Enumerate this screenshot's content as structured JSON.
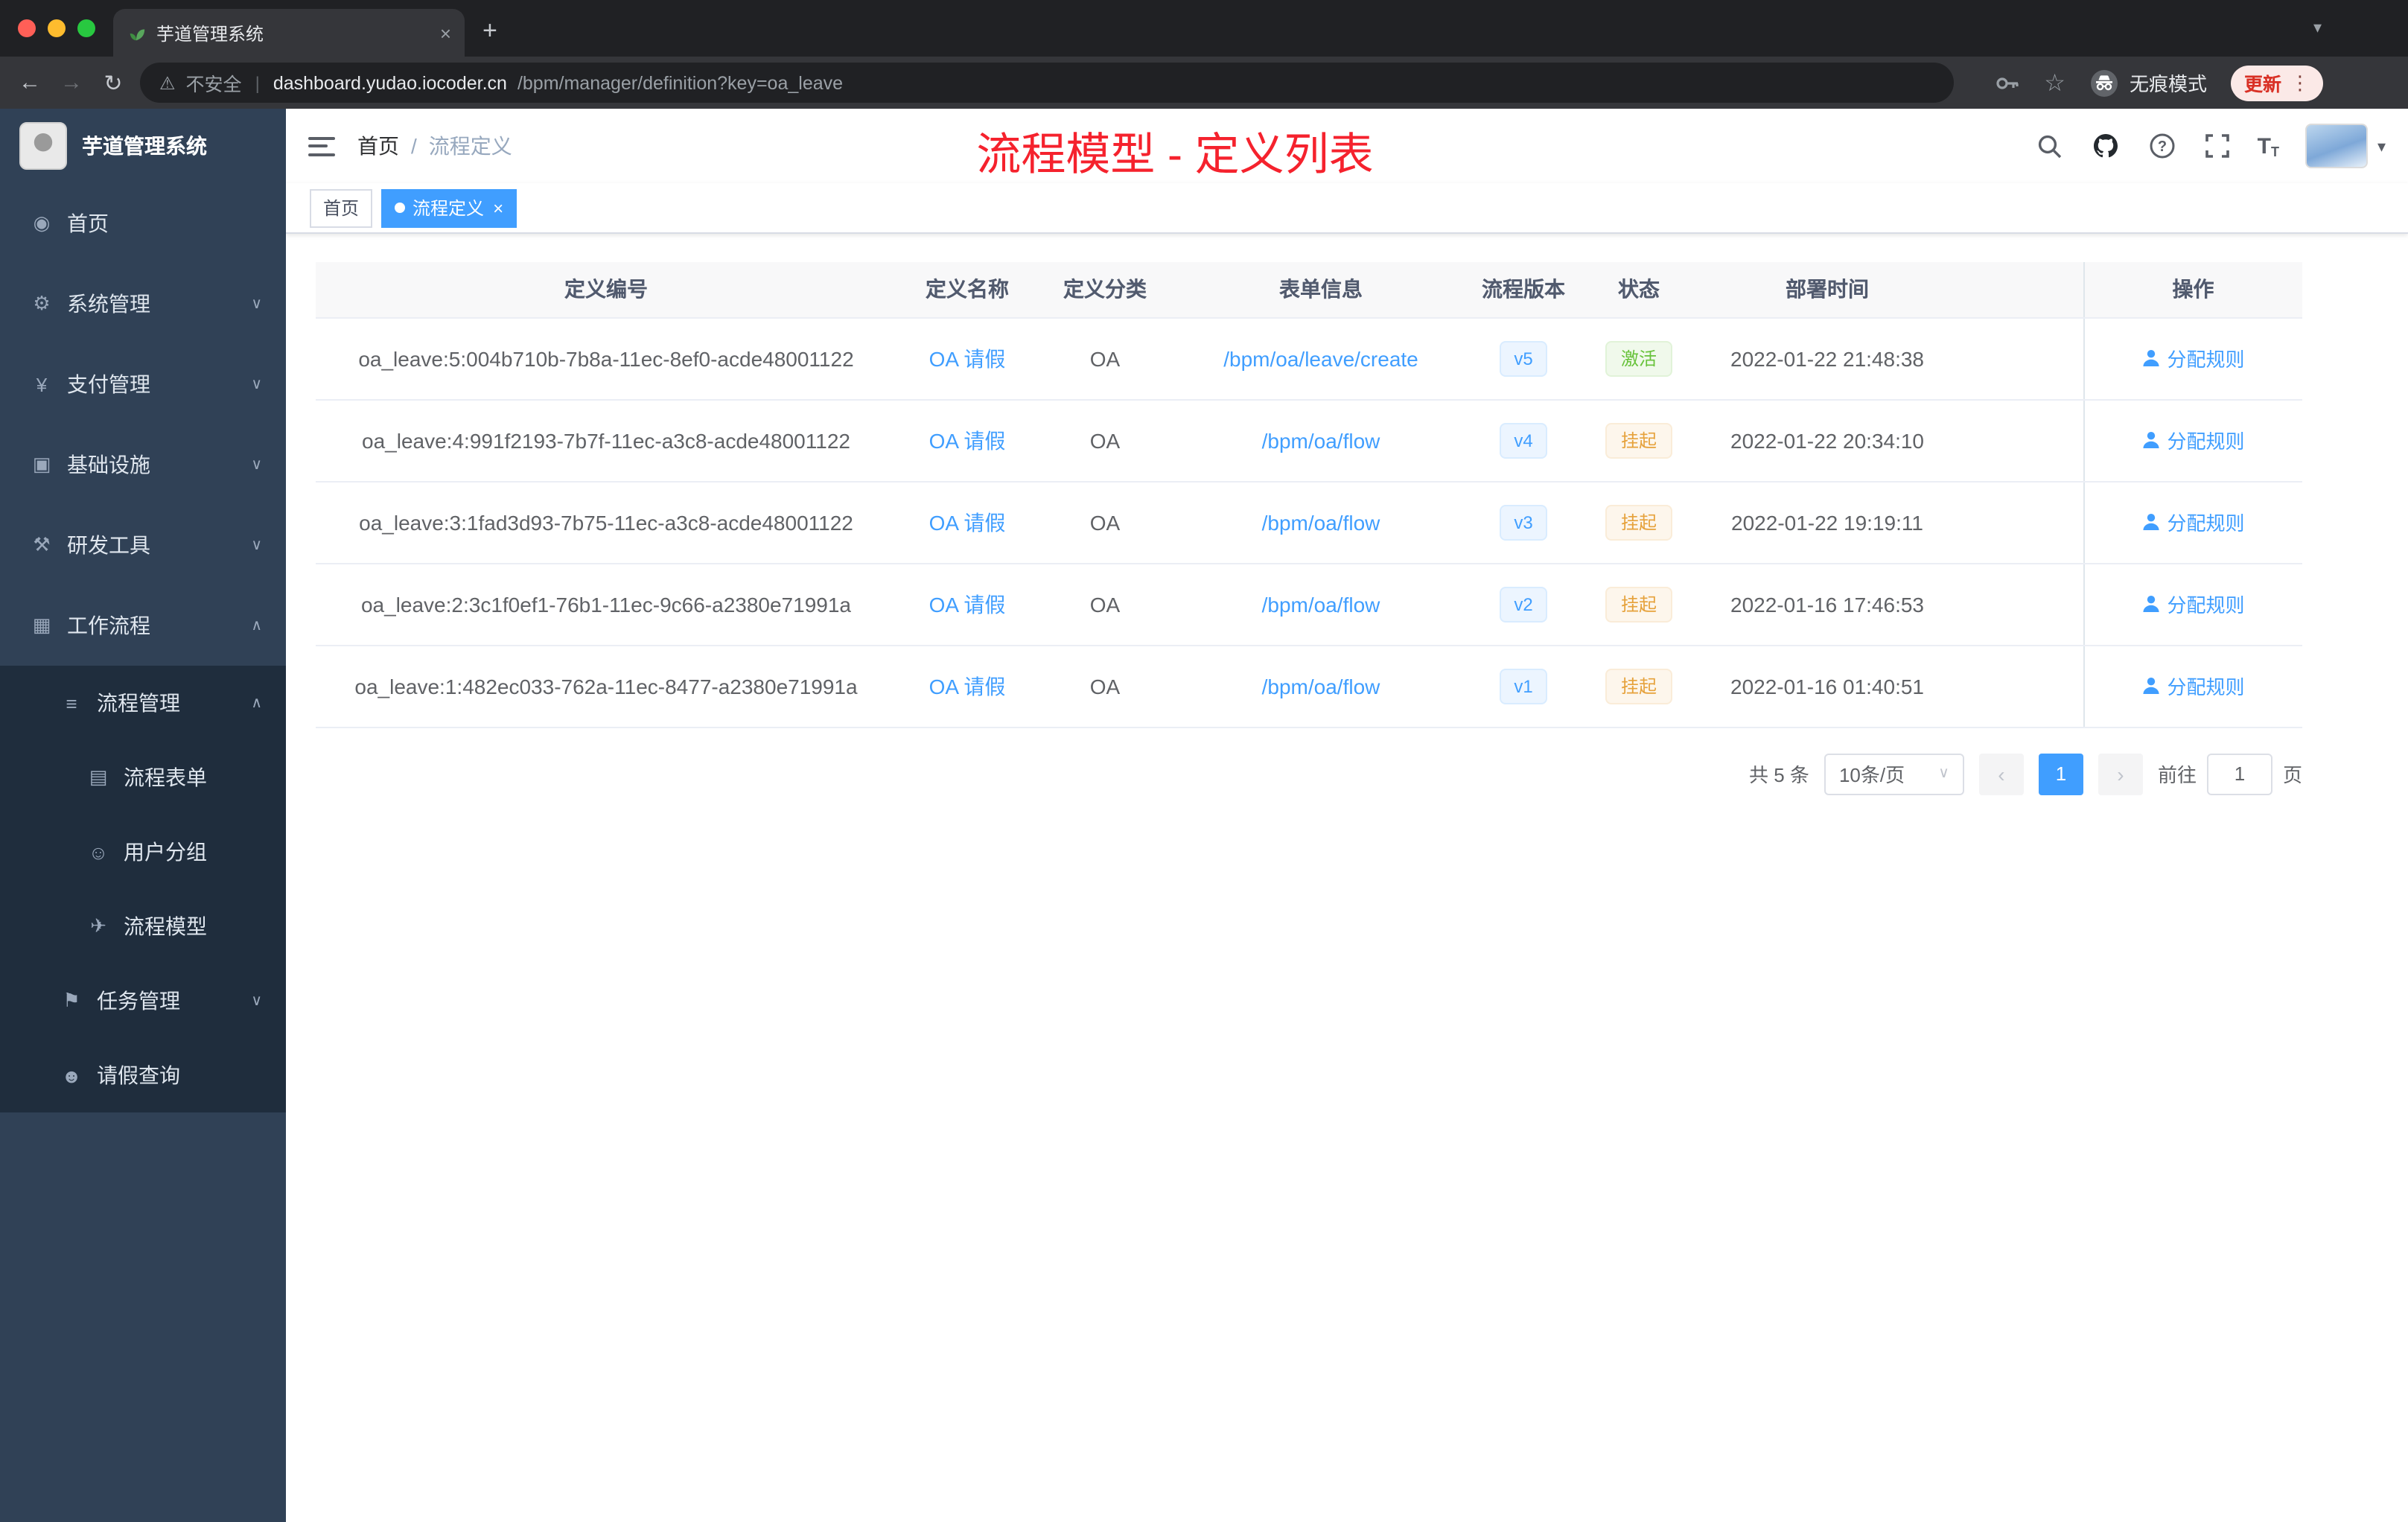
{
  "browser": {
    "tab_title": "芋道管理系统",
    "security_label": "不安全",
    "url_host": "dashboard.yudao.iocoder.cn",
    "url_path": "/bpm/manager/definition?key=oa_leave",
    "incognito_label": "无痕模式",
    "update_label": "更新"
  },
  "sidebar": {
    "logo_title": "芋道管理系统",
    "menu": [
      {
        "key": "home",
        "label": "首页",
        "icon": "dashboard-icon",
        "level": "top"
      },
      {
        "key": "system",
        "label": "系统管理",
        "icon": "gear-icon",
        "level": "top",
        "chevron": "down"
      },
      {
        "key": "payment",
        "label": "支付管理",
        "icon": "yen-icon",
        "level": "top",
        "chevron": "down"
      },
      {
        "key": "infrastructure",
        "label": "基础设施",
        "icon": "infrastructure-icon",
        "level": "top",
        "chevron": "down"
      },
      {
        "key": "devtools",
        "label": "研发工具",
        "icon": "tools-icon",
        "level": "top",
        "chevron": "down"
      },
      {
        "key": "workflow",
        "label": "工作流程",
        "icon": "workflow-icon",
        "level": "top",
        "chevron": "up"
      },
      {
        "key": "process-management",
        "label": "流程管理",
        "icon": "process-list-icon",
        "level": "sub1",
        "chevron": "up",
        "dark": true
      },
      {
        "key": "process-form",
        "label": "流程表单",
        "icon": "form-icon",
        "level": "sub2",
        "dark": true
      },
      {
        "key": "user-group",
        "label": "用户分组",
        "icon": "user-group-icon",
        "level": "sub2",
        "dark": true
      },
      {
        "key": "process-model",
        "label": "流程模型",
        "icon": "paper-plane-icon",
        "level": "sub2",
        "dark": true
      },
      {
        "key": "task-management",
        "label": "任务管理",
        "icon": "task-icon",
        "level": "sub1",
        "chevron": "down",
        "dark": true
      },
      {
        "key": "leave-query",
        "label": "请假查询",
        "icon": "person-icon",
        "level": "sub1",
        "dark": true
      }
    ]
  },
  "navbar": {
    "breadcrumb": [
      "首页",
      "流程定义"
    ],
    "breadcrumb_separator": "/",
    "annotation": "流程模型 - 定义列表"
  },
  "tags": {
    "items": [
      {
        "label": "首页",
        "active": false
      },
      {
        "label": "流程定义",
        "active": true
      }
    ]
  },
  "table": {
    "columns": [
      "定义编号",
      "定义名称",
      "定义分类",
      "表单信息",
      "流程版本",
      "状态",
      "部署时间",
      "操作"
    ],
    "rows": [
      {
        "id": "oa_leave:5:004b710b-7b8a-11ec-8ef0-acde48001122",
        "name": "OA 请假",
        "category": "OA",
        "form": "/bpm/oa/leave/create",
        "version": "v5",
        "status": "激活",
        "status_type": "success",
        "deploy_time": "2022-01-22 21:48:38",
        "action": "分配规则"
      },
      {
        "id": "oa_leave:4:991f2193-7b7f-11ec-a3c8-acde48001122",
        "name": "OA 请假",
        "category": "OA",
        "form": "/bpm/oa/flow",
        "version": "v4",
        "status": "挂起",
        "status_type": "warning",
        "deploy_time": "2022-01-22 20:34:10",
        "action": "分配规则"
      },
      {
        "id": "oa_leave:3:1fad3d93-7b75-11ec-a3c8-acde48001122",
        "name": "OA 请假",
        "category": "OA",
        "form": "/bpm/oa/flow",
        "version": "v3",
        "status": "挂起",
        "status_type": "warning",
        "deploy_time": "2022-01-22 19:19:11",
        "action": "分配规则"
      },
      {
        "id": "oa_leave:2:3c1f0ef1-76b1-11ec-9c66-a2380e71991a",
        "name": "OA 请假",
        "category": "OA",
        "form": "/bpm/oa/flow",
        "version": "v2",
        "status": "挂起",
        "status_type": "warning",
        "deploy_time": "2022-01-16 17:46:53",
        "action": "分配规则"
      },
      {
        "id": "oa_leave:1:482ec033-762a-11ec-8477-a2380e71991a",
        "name": "OA 请假",
        "category": "OA",
        "form": "/bpm/oa/flow",
        "version": "v1",
        "status": "挂起",
        "status_type": "warning",
        "deploy_time": "2022-01-16 01:40:51",
        "action": "分配规则"
      }
    ]
  },
  "pagination": {
    "total_label": "共 5 条",
    "page_size_label": "10条/页",
    "current_page": "1",
    "goto_label": "前往",
    "page_unit_label": "页",
    "goto_value": "1"
  },
  "icons": {
    "dashboard-icon": "◉",
    "gear-icon": "⚙",
    "yen-icon": "¥",
    "infrastructure-icon": "▣",
    "tools-icon": "⚒",
    "workflow-icon": "▦",
    "process-list-icon": "≡",
    "form-icon": "▤",
    "user-group-icon": "☺",
    "paper-plane-icon": "✈",
    "task-icon": "⚑",
    "person-icon": "☻",
    "chevron-down": "∨",
    "chevron-up": "∧",
    "caret-down": "▾",
    "close": "×",
    "plus": "+",
    "back-arrow": "←",
    "forward-arrow": "→",
    "reload": "↻",
    "warning-sign": "⚠",
    "star": "☆",
    "divider": "|",
    "menu-dots": "⋮",
    "page-prev": "‹",
    "page-next": "›"
  },
  "colors": {
    "accent": "#409eff",
    "sidebar_bg": "#304156",
    "sidebar_sub_bg": "#1f2d3d",
    "annotation_red": "#f5222d",
    "success_green": "#67c23a",
    "warning_orange": "#e6a23c"
  }
}
